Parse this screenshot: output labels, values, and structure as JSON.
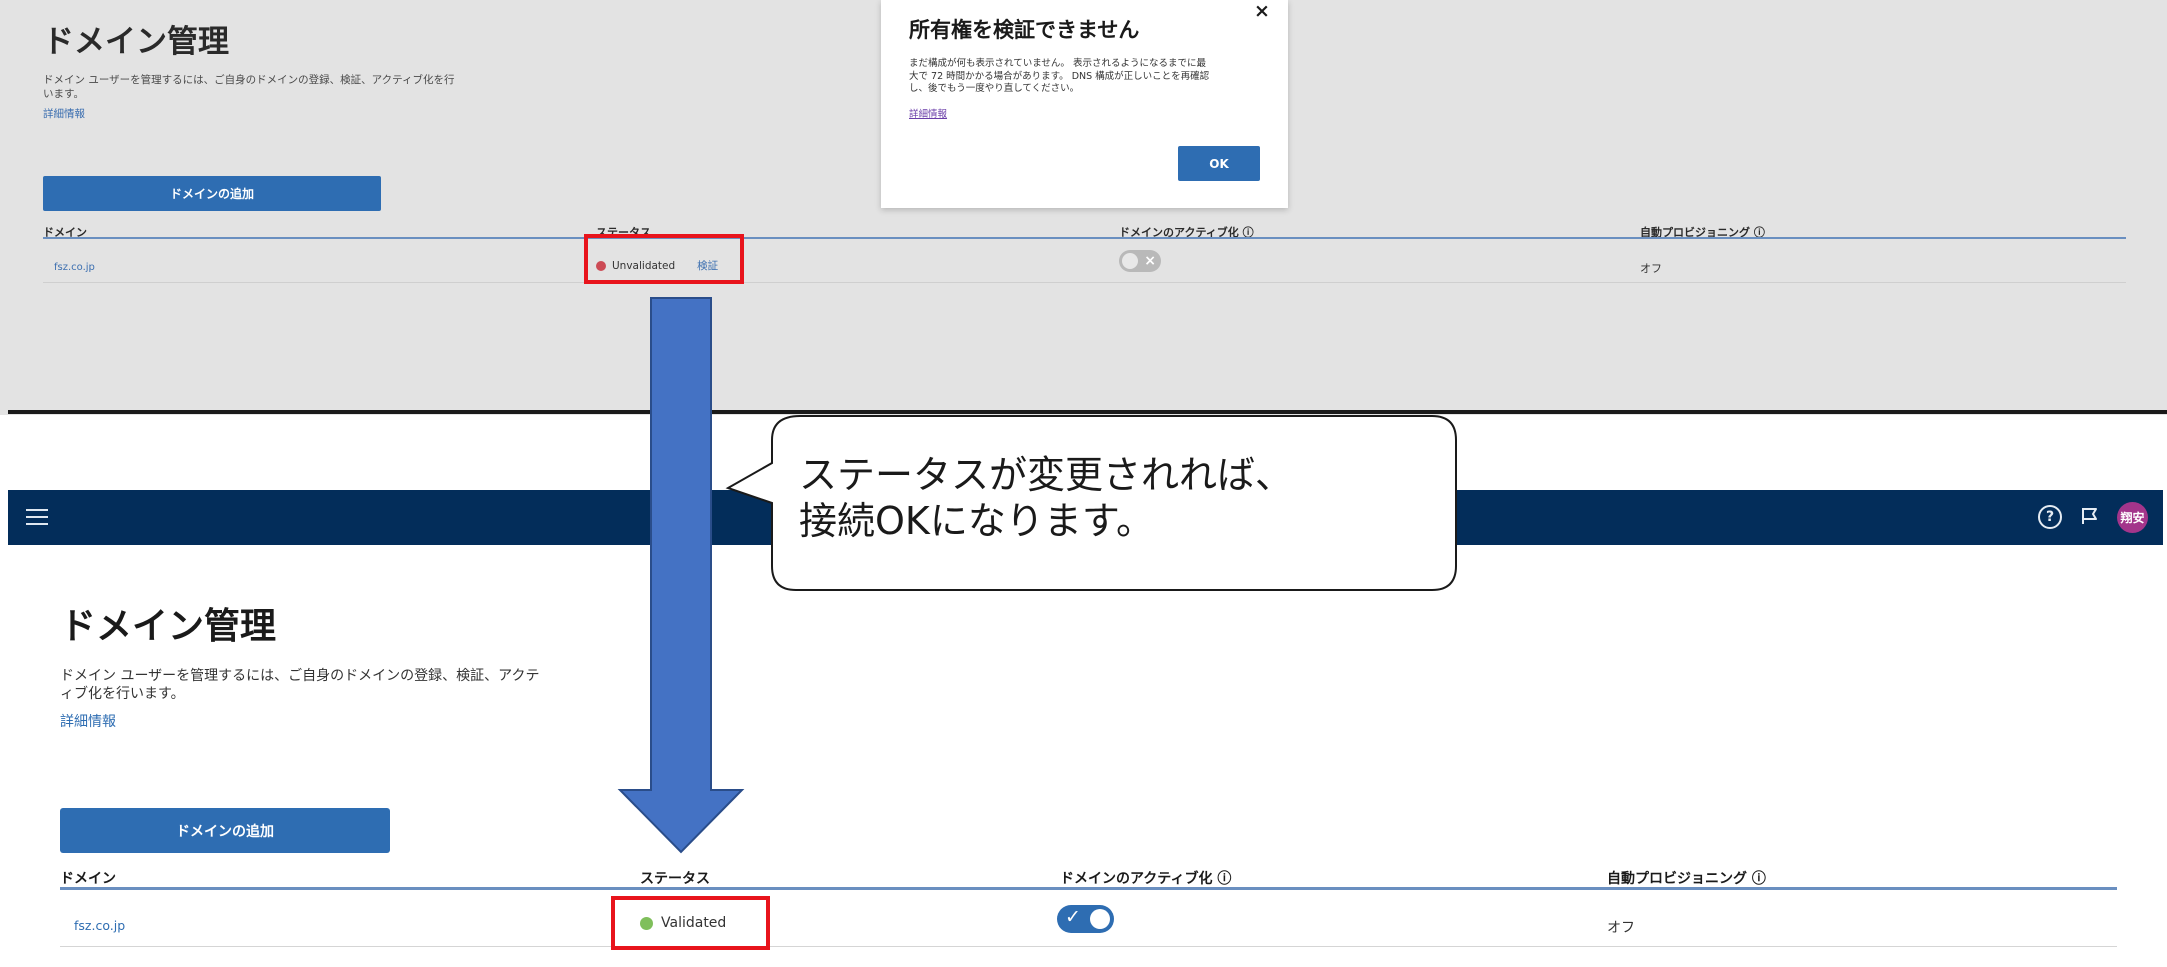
{
  "top": {
    "page_title": "ドメイン管理",
    "description": "ドメイン ユーザーを管理するには、ご自身のドメインの登録、検証、アクティブ化を行います。",
    "learn_more": "詳細情報",
    "add_domain_button": "ドメインの追加",
    "table": {
      "headers": [
        "ドメイン",
        "ステータス",
        "ドメインのアクティブ化 ⓘ",
        "自動プロビジョニング ⓘ"
      ],
      "row": {
        "domain": "fsz.co.jp",
        "status": "Unvalidated",
        "verify": "検証",
        "activation": "off",
        "auto_provisioning": "オフ"
      }
    },
    "dialog": {
      "title": "所有権を検証できません",
      "close": "×",
      "body_line1": "まだ構成が何も表示されていません。 表示されるようになるまでに最",
      "body_line2": "大で 72 時間かかる場合があります。 DNS 構成が正しいことを再確認",
      "body_line3": "し、後でもう一度やり直してください。",
      "link": "詳細情報",
      "ok_button": "OK"
    },
    "status_color": "#cc4b55"
  },
  "header": {
    "menu_icon": "hamburger-menu-icon",
    "help_icon": "help-circle-icon",
    "help_glyph": "?",
    "notification_icon": "megaphone-icon",
    "avatar_text": "翔安",
    "background": "#032d5a"
  },
  "bottom": {
    "page_title": "ドメイン管理",
    "description_line1": "ドメイン ユーザーを管理するには、ご自身のドメインの登録、検証、アクテ",
    "description_line2": "ィブ化を行います。",
    "learn_more": "詳細情報",
    "add_domain_button": "ドメインの追加",
    "table": {
      "headers": [
        "ドメイン",
        "ステータス",
        "ドメインのアクティブ化 ⓘ",
        "自動プロビジョニング ⓘ"
      ],
      "row": {
        "domain": "fsz.co.jp",
        "status": "Validated",
        "activation": "on",
        "auto_provisioning": "オフ"
      }
    },
    "status_color": "#7fbf5b"
  },
  "annotation": {
    "callout_line1": "ステータスが変更されれば、",
    "callout_line2": "接続OKになります。",
    "highlight_color": "#e8141c",
    "arrow_color": "#4472c4"
  }
}
